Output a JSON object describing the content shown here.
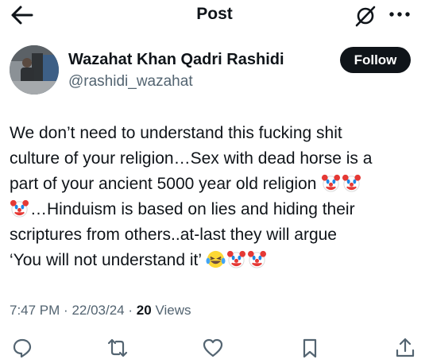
{
  "header": {
    "back_icon": "arrow-left-icon",
    "title": "Post",
    "grok_icon": "grok-icon",
    "more_icon": "more-horizontal-icon"
  },
  "author": {
    "name": "Wazahat Khan Qadri Rashidi",
    "handle": "@rashidi_wazahat",
    "follow_label": "Follow"
  },
  "post": {
    "lines": [
      "We don’t need to understand this fucking shit",
      "culture of your religion…Sex with dead horse is a",
      "part of your ancient 5000 year old religion",
      "…Hinduism is based on lies and hiding their",
      "scriptures from others..at-last they will argue",
      "‘You will not understand it’"
    ],
    "emoji": [
      "clown-face",
      "laughing-tears-face"
    ]
  },
  "meta": {
    "time": "7:47 PM",
    "separator": "·",
    "date": "22/03/24",
    "views_count": "20",
    "views_label": "Views"
  },
  "actions": [
    "reply-icon",
    "repost-icon",
    "like-icon",
    "bookmark-icon",
    "share-icon"
  ],
  "colors": {
    "text": "#0f1419",
    "secondary": "#536471",
    "follow_bg": "#0f1419",
    "follow_text": "#ffffff"
  }
}
